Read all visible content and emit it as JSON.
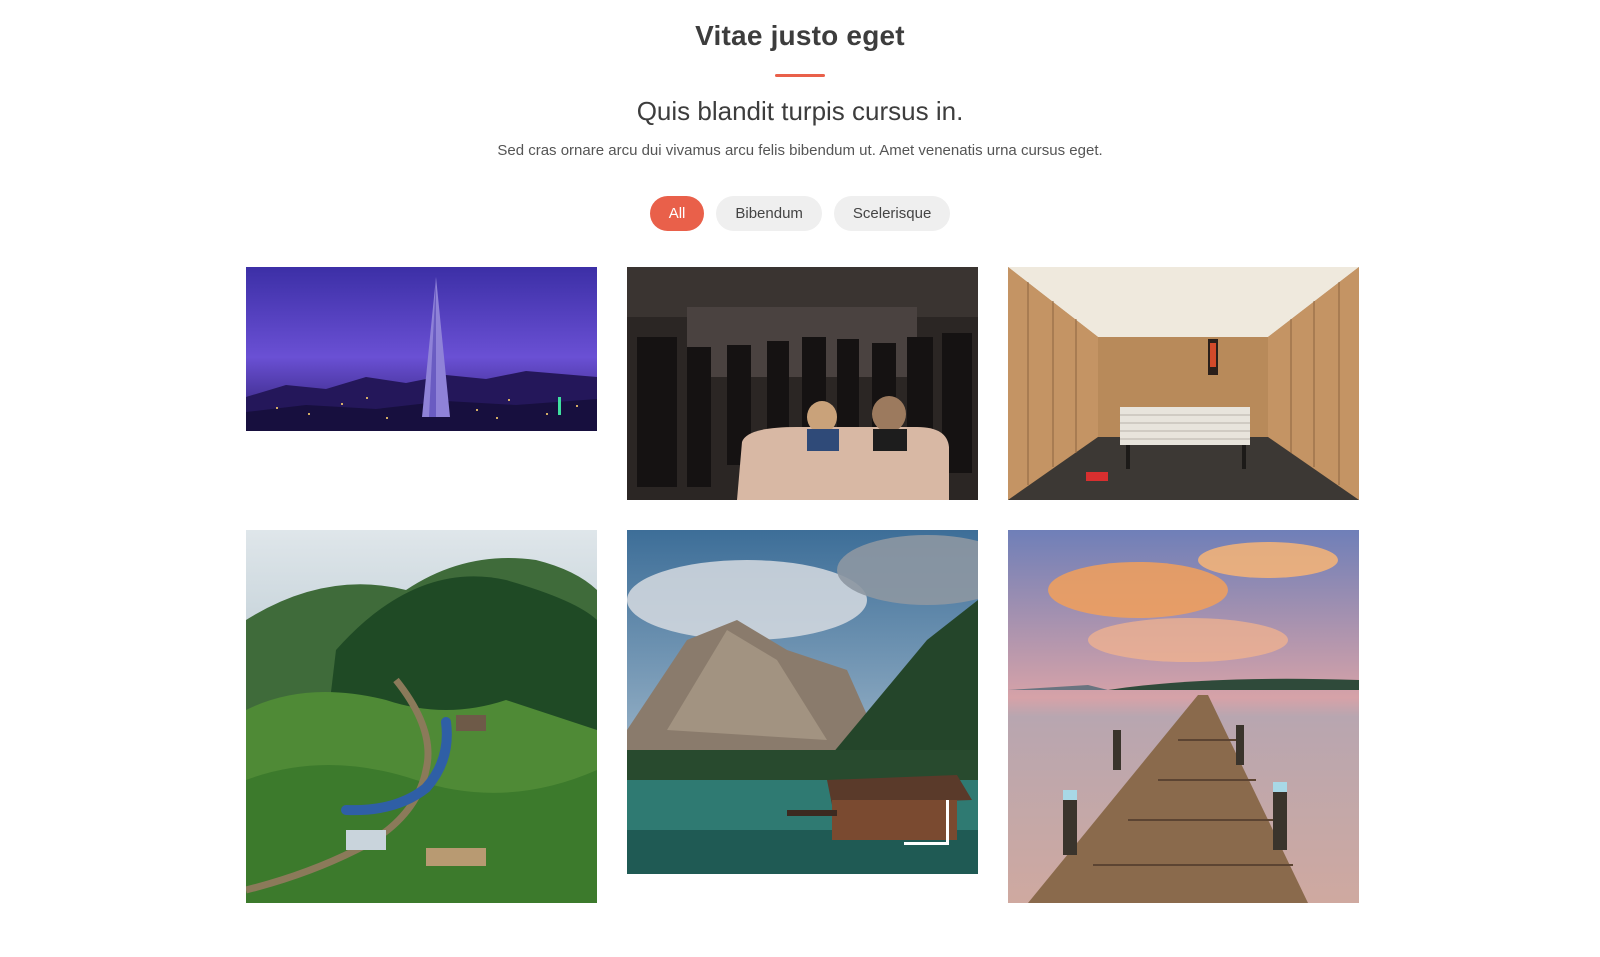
{
  "section": {
    "title": "Vitae justo eget",
    "subtitle": "Quis blandit turpis cursus in.",
    "description": "Sed cras ornare arcu dui vivamus arcu felis bibendum ut. Amet venenatis urna cursus eget."
  },
  "filters": [
    {
      "label": "All",
      "active": true
    },
    {
      "label": "Bibendum",
      "active": false
    },
    {
      "label": "Scelerisque",
      "active": false
    }
  ],
  "colors": {
    "accent": "#e9604a",
    "filter_bg": "#efefef",
    "text": "#3d3d3d"
  }
}
